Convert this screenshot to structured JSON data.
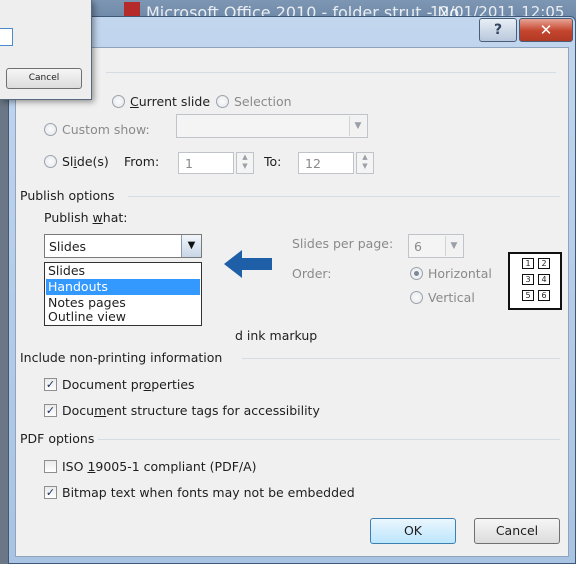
{
  "background": {
    "title": "Microsoft Office 2010 - folder strut - No",
    "date": "12/01/2011 12:05"
  },
  "titlebar": {
    "help_glyph": "?",
    "close_glyph": "✕"
  },
  "range": {
    "current_slide": "Current slide",
    "selection": "Selection",
    "custom_show": "Custom show:",
    "slides": "Slide(s)",
    "from_label": "From:",
    "from_value": "1",
    "to_label": "To:",
    "to_value": "12"
  },
  "publish_options": {
    "heading": "Publish options",
    "publish_what": "Publish what:",
    "selected": "Slides",
    "list": [
      "Slides",
      "Handouts",
      "Notes pages",
      "Outline view"
    ],
    "highlighted_index": 1,
    "slides_per_page_label": "Slides per page:",
    "slides_per_page_value": "6",
    "order_label": "Order:",
    "horizontal": "Horizontal",
    "vertical": "Vertical",
    "ink_markup_tail": "d ink markup",
    "grid_numbers": [
      "1",
      "2",
      "3",
      "4",
      "5",
      "6"
    ]
  },
  "non_printing": {
    "heading": "Include non-printing information",
    "document_properties": "Document properties",
    "structure_tags": "Document structure tags for accessibility"
  },
  "pdf_options": {
    "heading": "PDF options",
    "iso": "ISO 19005-1 compliant (PDF/A)",
    "bitmap": "Bitmap text when fonts may not be embedded"
  },
  "buttons": {
    "ok": "OK",
    "cancel": "Cancel"
  },
  "front_dialog": {
    "cancel": "Cancel"
  },
  "colors": {
    "accent_arrow": "#1f5fa8",
    "highlight": "#3399ff"
  }
}
